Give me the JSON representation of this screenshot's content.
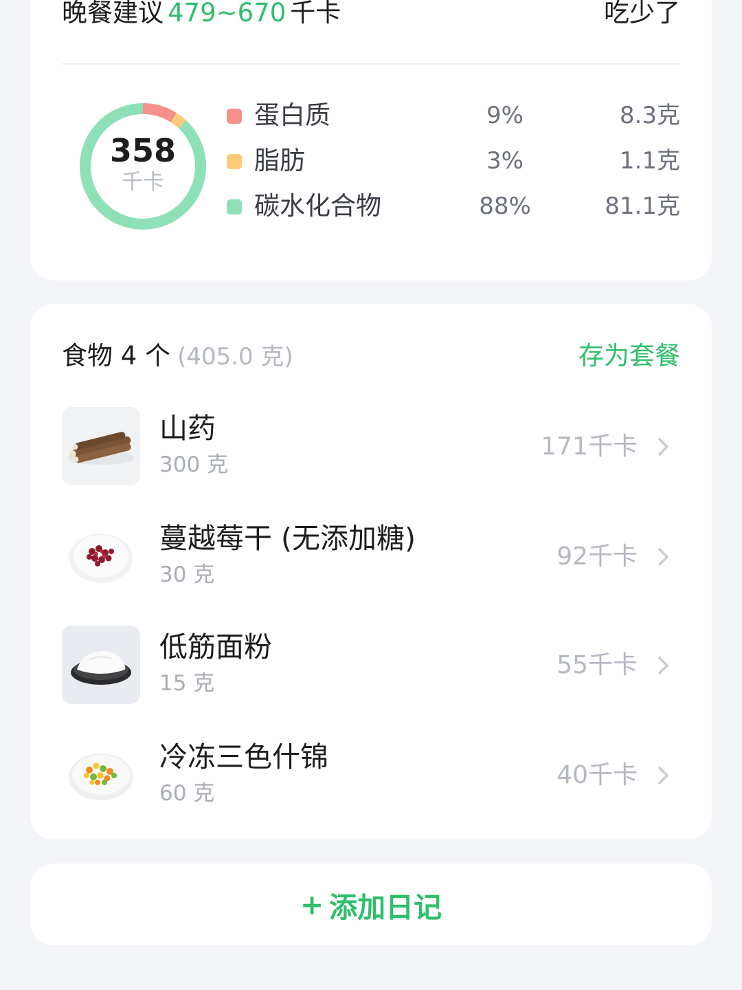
{
  "suggestion": {
    "label": "晚餐建议",
    "range": "479~670",
    "unit": "千卡",
    "status": "吃少了"
  },
  "energy": {
    "value": "358",
    "unit": "千卡"
  },
  "macros": [
    {
      "name": "蛋白质",
      "percent": "9%",
      "amount": "8.3克",
      "color": "#f6908a",
      "fraction": 0.09
    },
    {
      "name": "脂肪",
      "percent": "3%",
      "amount": "1.1克",
      "color": "#fccb75",
      "fraction": 0.03
    },
    {
      "name": "碳水化合物",
      "percent": "88%",
      "amount": "81.1克",
      "color": "#8ee0b7",
      "fraction": 0.88
    }
  ],
  "foods": {
    "title": "食物 4 个",
    "total_weight": "(405.0 克)",
    "save_label": "存为套餐",
    "items": [
      {
        "name": "山药",
        "weight": "300 克",
        "kcal": "171千卡",
        "icon": "yam-photo"
      },
      {
        "name": "蔓越莓干 (无添加糖)",
        "weight": "30 克",
        "kcal": "92千卡",
        "icon": "dried-cranberry-photo"
      },
      {
        "name": "低筋面粉",
        "weight": "15 克",
        "kcal": "55千卡",
        "icon": "flour-photo"
      },
      {
        "name": "冷冻三色什锦",
        "weight": "60 克",
        "kcal": "40千卡",
        "icon": "mixed-vegetables-photo"
      }
    ]
  },
  "add_diary": {
    "label": "添加日记",
    "icon": "plus-icon"
  },
  "colors": {
    "accent": "#2fbe6b",
    "background": "#f4f5f8"
  }
}
